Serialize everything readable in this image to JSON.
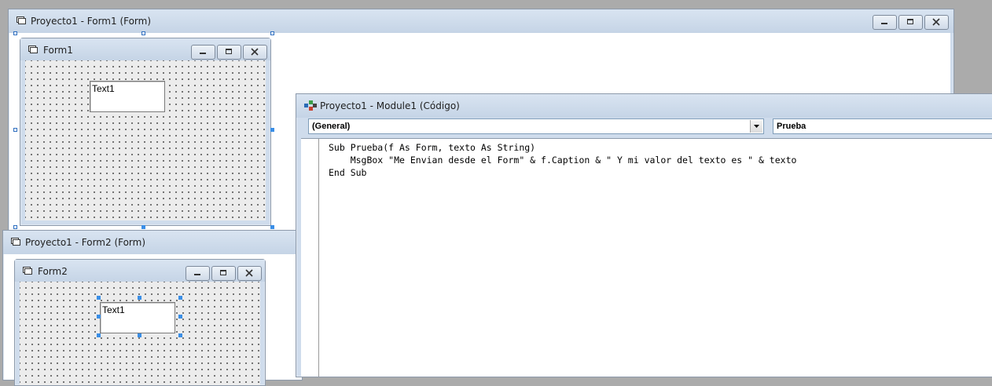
{
  "form1_designer": {
    "title": "Proyecto1 - Form1 (Form)",
    "form": {
      "caption": "Form1",
      "textbox": "Text1"
    }
  },
  "form2_designer": {
    "title": "Proyecto1 - Form2 (Form)",
    "form": {
      "caption": "Form2",
      "textbox": "Text1"
    }
  },
  "code_window": {
    "title": "Proyecto1 - Module1 (Código)",
    "object_combo": "(General)",
    "procedure_combo": "Prueba",
    "code_lines": [
      "Sub Prueba(f As Form, texto As String)",
      "    MsgBox \"Me Envian desde el Form\" & f.Caption & \" Y mi valor del texto es \" & texto",
      "End Sub"
    ]
  }
}
